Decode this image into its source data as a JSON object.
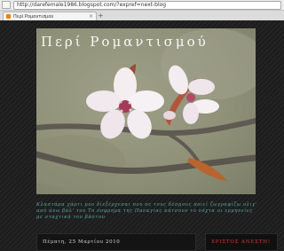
{
  "browser": {
    "url": "http://darefemale1986.blogspot.com/?expref=next-blog",
    "tab_title": "Περί Ρομαντισμού",
    "tab_close": "×",
    "new_tab": "+"
  },
  "blog": {
    "title": "Περί Ρομαντισμού",
    "description": "Κλαστάμα χάρτι μου διεξέρχεσαι που σε τους δέσμους ποιεί ζωγραφίζω ολιγ' από άνω βάλ' του Το όσφρημα της Παναγίας κάτσουν το νόχτα οι ερμηνείες με σταχτικά του βάστου",
    "colors": {
      "background": "#1e1e1e",
      "description": "#5aa6a0",
      "sidebar_heading": "#d33b2e"
    }
  },
  "post": {
    "date": "Πέμπτη, 25 Μαρτίου 2010"
  },
  "sidebar": {
    "heading": "ΧΡΙΣΤΟΣ ΑΝΕΣΤΗ!"
  }
}
